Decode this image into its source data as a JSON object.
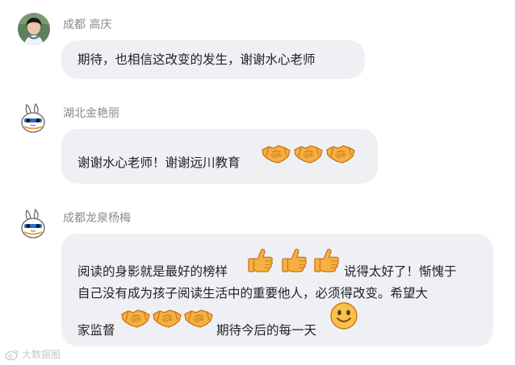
{
  "messages": [
    {
      "name": "成都 高庆",
      "text": "期待，也相信这改变的发生，谢谢水心老师",
      "avatar": "photo-avatar"
    },
    {
      "name": "湖北金艳丽",
      "text": "谢谢水心老师！谢谢远川教育",
      "emojis": [
        "handshake-emoji",
        "handshake-emoji",
        "handshake-emoji"
      ],
      "avatar": "bunny-avatar"
    },
    {
      "name": "成都龙泉杨梅",
      "line1_a": "阅读的身影就是最好的榜样",
      "line1_emojis": [
        "thumbs-up-emoji",
        "thumbs-up-emoji",
        "thumbs-up-emoji"
      ],
      "line1_b": "说得太好了！惭愧于",
      "line2": "自己没有成为孩子阅读生活中的重要他人，必须得改变。希望大",
      "line3_a": "家监督",
      "line3_emojis": [
        "handshake-emoji",
        "handshake-emoji",
        "handshake-emoji"
      ],
      "line3_b": "期待今后的每一天",
      "line3_tail_emoji": "smile-emoji",
      "avatar": "bunny-avatar"
    }
  ],
  "watermark": {
    "text": "大数据圈",
    "icon": "weibo-icon"
  },
  "colors": {
    "bubble": "#eef0f4",
    "name": "#8a8a8a",
    "emoji_fill": "#f5b041",
    "emoji_stroke": "#d67f1e"
  }
}
